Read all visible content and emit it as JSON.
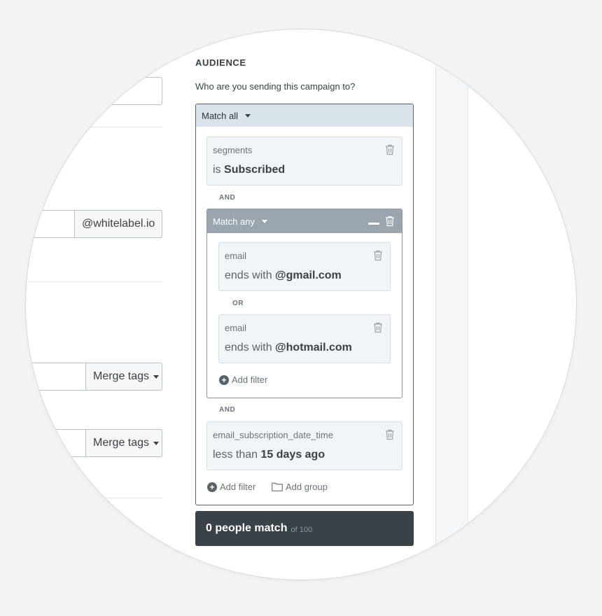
{
  "left_form": {
    "domain_addon": "@whitelabel.io",
    "merge_tags_1": "Merge tags",
    "merge_tags_2": "Merge tags"
  },
  "audience": {
    "heading": "AUDIENCE",
    "subtitle": "Who are you sending this campaign to?",
    "root_match": "Match all",
    "filter_segments": {
      "field": "segments",
      "operator": "is",
      "value": "Subscribed"
    },
    "and_1": "AND",
    "group": {
      "match": "Match any",
      "filter_gmail": {
        "field": "email",
        "operator": "ends with",
        "value": "@gmail.com"
      },
      "or": "OR",
      "filter_hotmail": {
        "field": "email",
        "operator": "ends with",
        "value": "@hotmail.com"
      },
      "add_filter": "Add filter"
    },
    "and_2": "AND",
    "filter_date": {
      "field": "email_subscription_date_time",
      "operator": "less than",
      "value": "15 days ago"
    },
    "add_filter": "Add filter",
    "add_group": "Add group",
    "match_count": "0 people match",
    "match_total": "of 100"
  },
  "colors": {
    "panel_head": "#d9e3ea",
    "group_head": "#9aa5ad",
    "match_bar": "#394247"
  }
}
